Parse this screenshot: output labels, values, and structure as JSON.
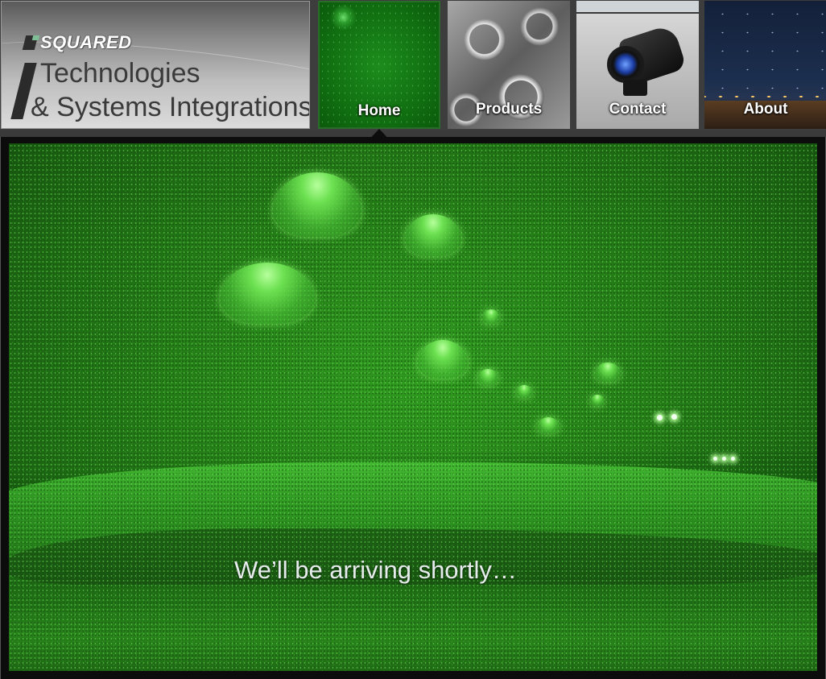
{
  "logo": {
    "brand": "SQUARED",
    "line1": "Technologies",
    "line2": "& Systems Integrations"
  },
  "nav": {
    "items": [
      {
        "label": "Home",
        "active": true
      },
      {
        "label": "Products",
        "active": false
      },
      {
        "label": "Contact",
        "active": false
      },
      {
        "label": "About",
        "active": false
      }
    ]
  },
  "hero": {
    "tagline": "We’ll be arriving shortly…"
  },
  "colors": {
    "header_bg": "#3d3d3d",
    "night_vision_green": "#2f9a1f",
    "panel_frame": "#0c0c0c",
    "nav_text": "#ffffff"
  }
}
